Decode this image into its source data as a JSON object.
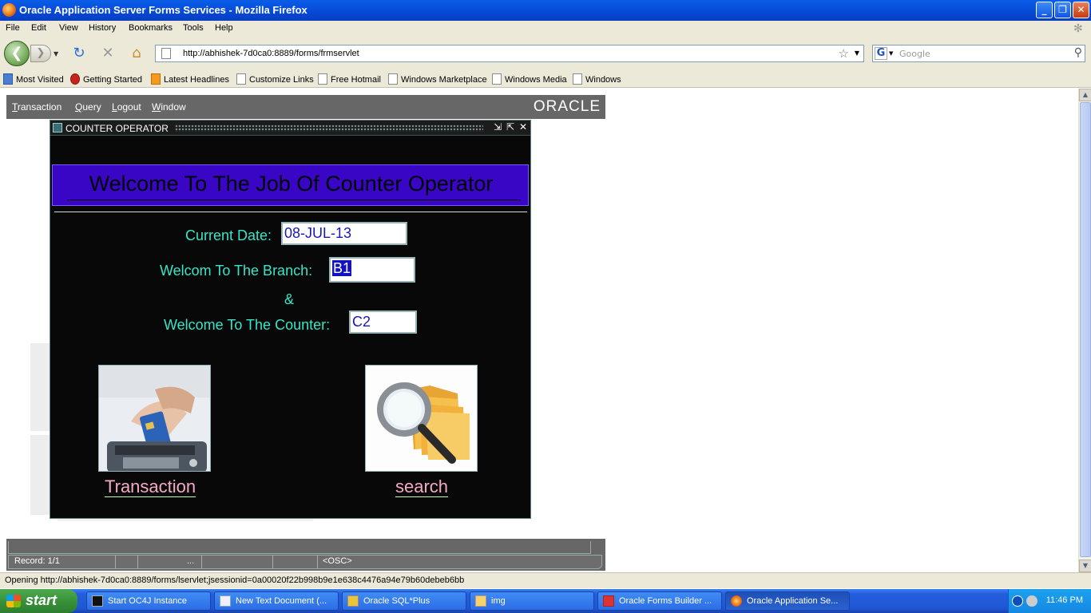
{
  "window": {
    "title": "Oracle Application Server Forms Services - Mozilla Firefox",
    "minimize": "_",
    "maximize": "❐",
    "close": "✕"
  },
  "menu": [
    "File",
    "Edit",
    "View",
    "History",
    "Bookmarks",
    "Tools",
    "Help"
  ],
  "nav": {
    "url": "http://abhishek-7d0ca0:8889/forms/frmservlet",
    "search_placeholder": "Google"
  },
  "bookmarks": [
    "Most Visited",
    "Getting Started",
    "Latest Headlines",
    "Customize Links",
    "Free Hotmail",
    "Windows Marketplace",
    "Windows Media",
    "Windows"
  ],
  "applet": {
    "menu": {
      "transaction_first": "T",
      "transaction_rest": "ransaction",
      "query_first": "Q",
      "query_rest": "uery",
      "logout_first": "L",
      "logout_rest": "ogout",
      "window_first": "W",
      "window_rest": "indow"
    },
    "logo": "ORACLE",
    "form": {
      "title": "COUNTER OPERATOR",
      "banner": "Welcome To The Job Of Counter Operator",
      "date_label": "Current Date:",
      "date_value": "08-JUL-13",
      "branch_label": "Welcom To The Branch:",
      "branch_value": "B1",
      "ampersand": "&",
      "counter_label": "Welcome To The Counter:",
      "counter_value": "C2",
      "transaction_button": "Transaction",
      "search_button": "search"
    },
    "status": {
      "record": "Record: 1/1",
      "ellipsis": "...",
      "osc": "<OSC>"
    }
  },
  "status_bar": "Opening http://abhishek-7d0ca0:8889/forms/lservlet;jsessionid=0a00020f22b998b9e1e638c4476a94e79b60debeb6bb",
  "taskbar": {
    "start": "start",
    "tasks": [
      "Start OC4J Instance",
      "New Text Document (...",
      "Oracle SQL*Plus",
      "img",
      "Oracle Forms Builder ...",
      "Oracle Application Se..."
    ],
    "clock": "11:46 PM"
  },
  "colors": {
    "banner": "#3a06c6",
    "label_cyan": "#35e6c9",
    "field_text": "#1a16b8",
    "button_label_pink": "#f5a9c8"
  }
}
